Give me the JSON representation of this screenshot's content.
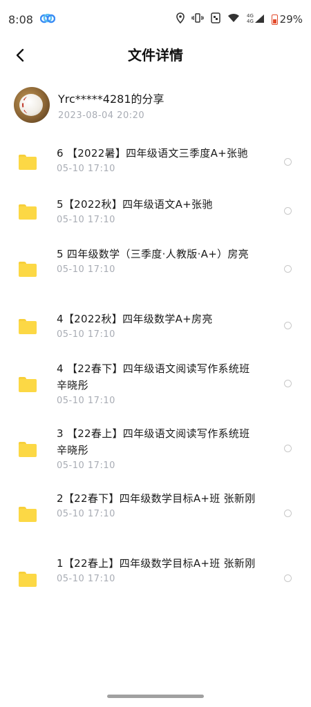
{
  "status_bar": {
    "time": "8:08",
    "signal_label": "4G 4G",
    "battery_percent": "29%",
    "battery_color": "#e24a2b"
  },
  "header": {
    "title": "文件详情",
    "back_icon": "chevron-left-icon"
  },
  "sharer": {
    "name": "Yrc*****4281的分享",
    "time": "2023-08-04  20:20"
  },
  "files": [
    {
      "name": "6 【2022暑】四年级语文三季度A+张驰",
      "time": "05-10  17:10"
    },
    {
      "name": "5【2022秋】四年级语文A+张驰",
      "time": "05-10  17:10"
    },
    {
      "name": "5 四年级数学（三季度·人教版·A+）房亮",
      "time": "05-10  17:10"
    },
    {
      "name": "4【2022秋】四年级数学A+房亮",
      "time": "05-10  17:10"
    },
    {
      "name": "4 【22春下】四年级语文阅读写作系统班  辛晓彤",
      "time": "05-10  17:10"
    },
    {
      "name": "3 【22春上】四年级语文阅读写作系统班  辛晓彤",
      "time": "05-10  17:10"
    },
    {
      "name": "2【22春下】四年级数学目标A+班  张新刚",
      "time": "05-10  17:10"
    },
    {
      "name": "1【22春上】四年级数学目标A+班  张新刚",
      "time": "05-10  17:10"
    }
  ],
  "colors": {
    "folder": "#fcd845",
    "secondary_text": "#a8acb4"
  }
}
